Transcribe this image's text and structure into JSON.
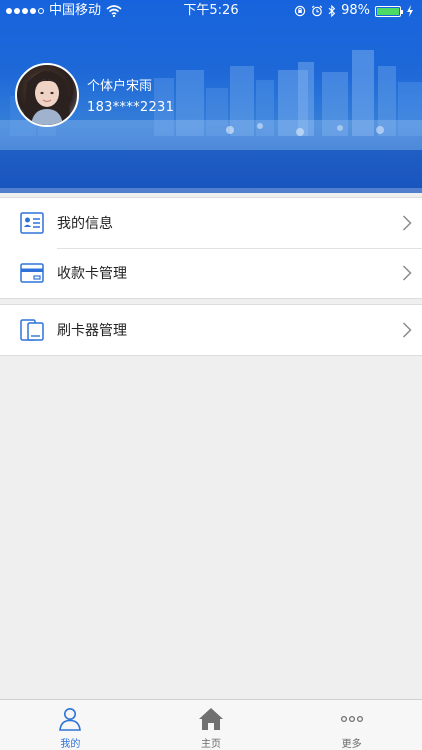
{
  "status_bar": {
    "carrier": "中国移动",
    "time": "下午5:26",
    "battery_percent": "98%",
    "battery_level": 0.98,
    "icons": [
      "signal-dots",
      "wifi-icon",
      "orientation-lock-icon",
      "alarm-icon",
      "bluetooth-icon",
      "battery-icon",
      "charging-icon"
    ]
  },
  "profile": {
    "name": "个体户宋雨",
    "phone": "183****2231",
    "avatar_icon": "user-photo"
  },
  "menu_groups": [
    {
      "items": [
        {
          "label": "我的信息",
          "icon": "contact-card-icon"
        },
        {
          "label": "收款卡管理",
          "icon": "bank-card-icon"
        }
      ]
    },
    {
      "items": [
        {
          "label": "刷卡器管理",
          "icon": "card-reader-icon"
        }
      ]
    }
  ],
  "tab_bar": {
    "tabs": [
      {
        "label": "我的",
        "icon": "person-icon",
        "active": true
      },
      {
        "label": "主页",
        "icon": "home-icon",
        "active": false
      },
      {
        "label": "更多",
        "icon": "more-icon",
        "active": false
      }
    ]
  },
  "colors": {
    "accent": "#2f73d9",
    "header_blue": "#1f6ad8",
    "background": "#efefef",
    "battery_green": "#4cd964"
  }
}
